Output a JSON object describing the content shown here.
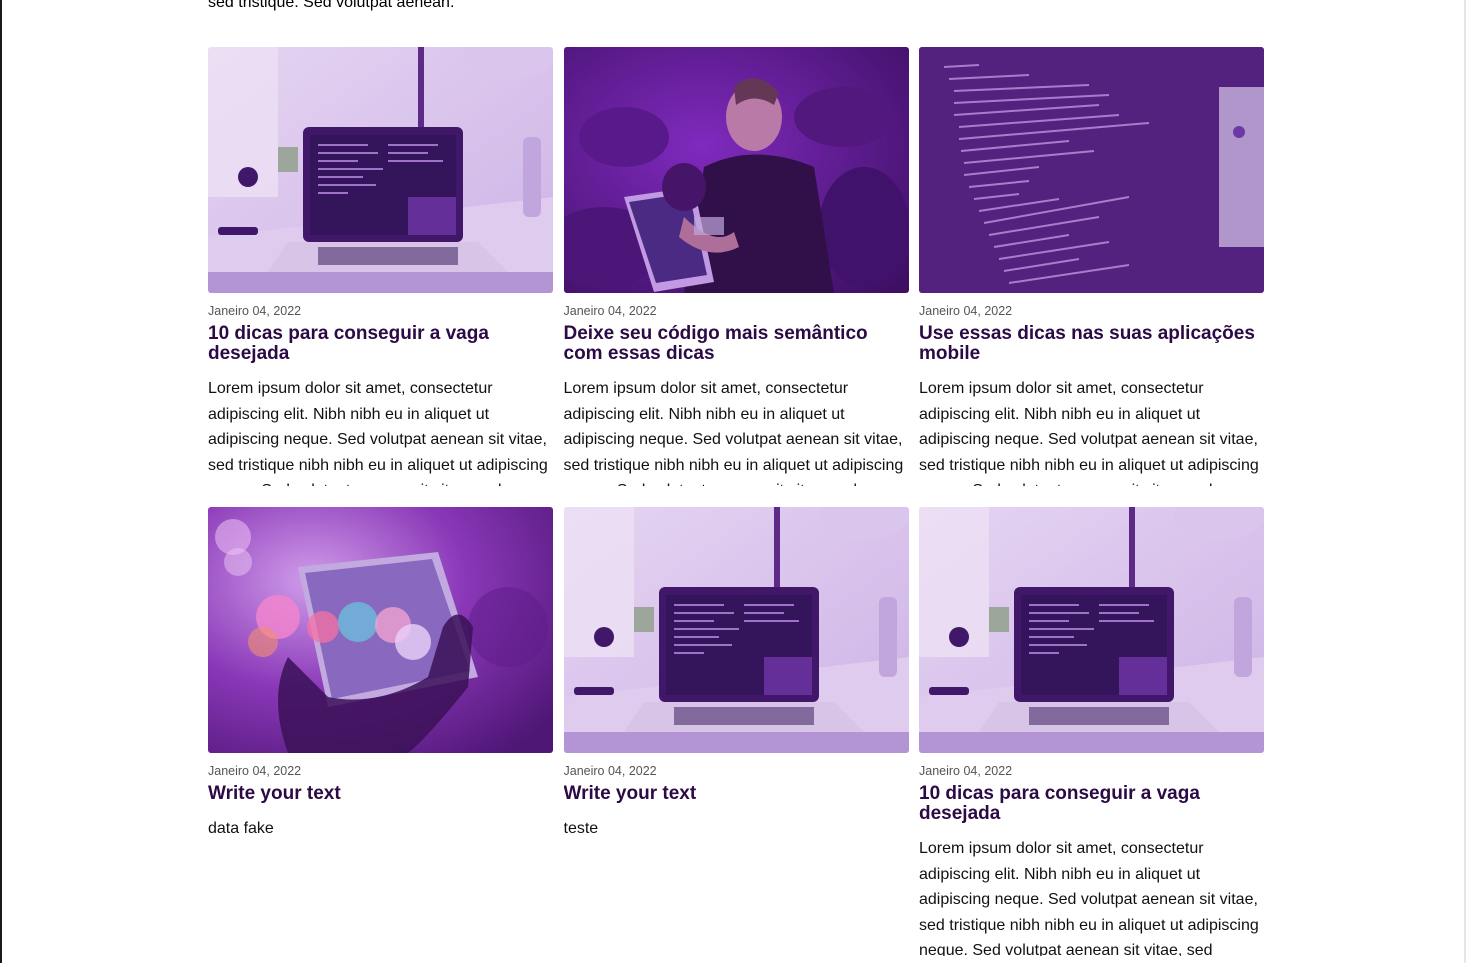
{
  "top_fragment": "sed tristique. Sed volutpat aenean.",
  "posts": [
    {
      "image": "laptop-desk",
      "date": "Janeiro 04, 2022",
      "title": "10 dicas para conseguir a vaga desejada",
      "excerpt": "Lorem ipsum dolor sit amet, consectetur adipiscing elit. Nibh nibh eu in aliquet ut adipiscing neque. Sed volutpat aenean sit vitae, sed tristique nibh nibh eu in aliquet ut adipiscing neque. Sed volutpat aenean sit vitae, sed"
    },
    {
      "image": "man-coding",
      "date": "Janeiro 04, 2022",
      "title": "Deixe seu código mais semântico com essas dicas",
      "excerpt": "Lorem ipsum dolor sit amet, consectetur adipiscing elit. Nibh nibh eu in aliquet ut adipiscing neque. Sed volutpat aenean sit vitae, sed tristique nibh nibh eu in aliquet ut adipiscing neque. Sed volutpat aenean sit vitae, sed"
    },
    {
      "image": "code-screen",
      "date": "Janeiro 04, 2022",
      "title": "Use essas dicas nas suas aplicações mobile",
      "excerpt": "Lorem ipsum dolor sit amet, consectetur adipiscing elit. Nibh nibh eu in aliquet ut adipiscing neque. Sed volutpat aenean sit vitae, sed tristique nibh nibh eu in aliquet ut adipiscing neque. Sed volutpat aenean sit vitae, sed"
    },
    {
      "image": "phone-bokeh",
      "date": "Janeiro 04, 2022",
      "title": "Write your text",
      "excerpt": "data fake"
    },
    {
      "image": "laptop-desk",
      "date": "Janeiro 04, 2022",
      "title": "Write your text",
      "excerpt": "teste"
    },
    {
      "image": "laptop-desk",
      "date": "Janeiro 04, 2022",
      "title": "10 dicas para conseguir a vaga desejada",
      "excerpt": "Lorem ipsum dolor sit amet, consectetur adipiscing elit. Nibh nibh eu in aliquet ut adipiscing neque. Sed volutpat aenean sit vitae, sed tristique nibh nibh eu in aliquet ut adipiscing neque. Sed volutpat aenean sit vitae, sed"
    }
  ],
  "colors": {
    "title": "#2c0a45",
    "date": "#555555",
    "overlay_purple": "#7a1fb0"
  }
}
